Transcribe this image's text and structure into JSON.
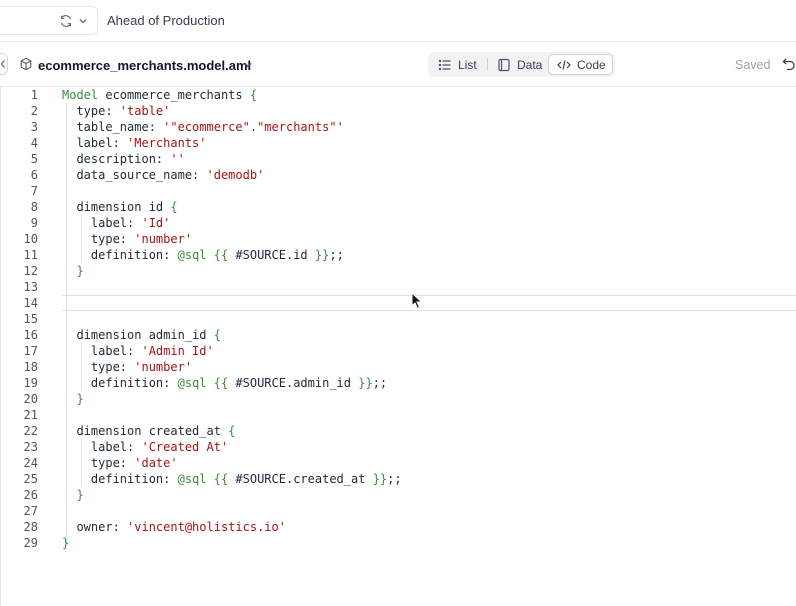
{
  "topbar": {
    "branch_name": "Ahead of Production",
    "icons": [
      "sync-icon",
      "chevron-down-icon"
    ]
  },
  "filebar": {
    "file_name": "ecommerce_merchants.model.aml",
    "view_toggle": {
      "list": "List",
      "data": "Data",
      "code": "Code",
      "active": "Code"
    },
    "saved": "Saved",
    "icons": [
      "cube-icon",
      "chevron-down-icon",
      "list-icon",
      "data-icon",
      "code-icon",
      "undo-icon"
    ]
  },
  "editor": {
    "lines": [
      {
        "n": "1",
        "parts": [
          [
            "k",
            "Model"
          ],
          [
            "t",
            " ecommerce_merchants "
          ],
          [
            "k",
            "{"
          ]
        ]
      },
      {
        "n": "2",
        "parts": [
          [
            "t",
            "  type: "
          ],
          [
            "s",
            "'table'"
          ]
        ]
      },
      {
        "n": "3",
        "parts": [
          [
            "t",
            "  table_name: "
          ],
          [
            "s",
            "'\"ecommerce\".\"merchants\"'"
          ]
        ]
      },
      {
        "n": "4",
        "parts": [
          [
            "t",
            "  label: "
          ],
          [
            "s",
            "'Merchants'"
          ]
        ]
      },
      {
        "n": "5",
        "parts": [
          [
            "t",
            "  description: "
          ],
          [
            "s",
            "''"
          ]
        ]
      },
      {
        "n": "6",
        "parts": [
          [
            "t",
            "  data_source_name: "
          ],
          [
            "s",
            "'demodb'"
          ]
        ]
      },
      {
        "n": "7",
        "parts": []
      },
      {
        "n": "8",
        "parts": [
          [
            "t",
            "  dimension id "
          ],
          [
            "k",
            "{"
          ]
        ]
      },
      {
        "n": "9",
        "parts": [
          [
            "t",
            "    label: "
          ],
          [
            "s",
            "'Id'"
          ]
        ]
      },
      {
        "n": "10",
        "parts": [
          [
            "t",
            "    type: "
          ],
          [
            "s",
            "'number'"
          ]
        ]
      },
      {
        "n": "11",
        "parts": [
          [
            "t",
            "    definition: "
          ],
          [
            "k",
            "@sql"
          ],
          [
            "t",
            " "
          ],
          [
            "k",
            "{{"
          ],
          [
            "t",
            " #SOURCE.id "
          ],
          [
            "k",
            "}}"
          ],
          [
            "t",
            ";;"
          ]
        ]
      },
      {
        "n": "12",
        "parts": [
          [
            "t",
            "  "
          ],
          [
            "k",
            "}"
          ]
        ]
      },
      {
        "n": "13",
        "parts": []
      },
      {
        "n": "14",
        "parts": []
      },
      {
        "n": "15",
        "parts": []
      },
      {
        "n": "16",
        "parts": [
          [
            "t",
            "  dimension admin_id "
          ],
          [
            "k",
            "{"
          ]
        ]
      },
      {
        "n": "17",
        "parts": [
          [
            "t",
            "    label: "
          ],
          [
            "s",
            "'Admin Id'"
          ]
        ]
      },
      {
        "n": "18",
        "parts": [
          [
            "t",
            "    type: "
          ],
          [
            "s",
            "'number'"
          ]
        ]
      },
      {
        "n": "19",
        "parts": [
          [
            "t",
            "    definition: "
          ],
          [
            "k",
            "@sql"
          ],
          [
            "t",
            " "
          ],
          [
            "k",
            "{{"
          ],
          [
            "t",
            " #SOURCE.admin_id "
          ],
          [
            "k",
            "}}"
          ],
          [
            "t",
            ";;"
          ]
        ]
      },
      {
        "n": "20",
        "parts": [
          [
            "t",
            "  "
          ],
          [
            "k",
            "}"
          ]
        ]
      },
      {
        "n": "21",
        "parts": []
      },
      {
        "n": "22",
        "parts": [
          [
            "t",
            "  dimension created_at "
          ],
          [
            "k",
            "{"
          ]
        ]
      },
      {
        "n": "23",
        "parts": [
          [
            "t",
            "    label: "
          ],
          [
            "s",
            "'Created At'"
          ]
        ]
      },
      {
        "n": "24",
        "parts": [
          [
            "t",
            "    type: "
          ],
          [
            "s",
            "'date'"
          ]
        ]
      },
      {
        "n": "25",
        "parts": [
          [
            "t",
            "    definition: "
          ],
          [
            "k",
            "@sql"
          ],
          [
            "t",
            " "
          ],
          [
            "k",
            "{{"
          ],
          [
            "t",
            " #SOURCE.created_at "
          ],
          [
            "k",
            "}}"
          ],
          [
            "t",
            ";;"
          ]
        ]
      },
      {
        "n": "26",
        "parts": [
          [
            "t",
            "  "
          ],
          [
            "k",
            "}"
          ]
        ]
      },
      {
        "n": "27",
        "parts": []
      },
      {
        "n": "28",
        "parts": [
          [
            "t",
            "  owner: "
          ],
          [
            "s",
            "'vincent@holistics.io'"
          ]
        ]
      },
      {
        "n": "29",
        "parts": [
          [
            "k",
            "}"
          ]
        ]
      }
    ],
    "active_line": "14"
  },
  "colors": {
    "keyword": "#3a8a3a",
    "string": "#a31515",
    "text": "#1f2937",
    "line_number": "#555555"
  }
}
